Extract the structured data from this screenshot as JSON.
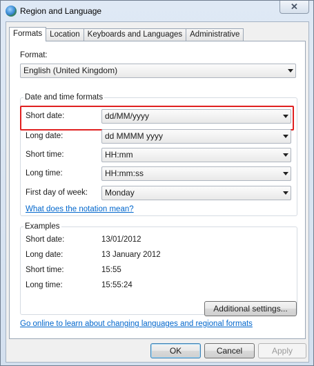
{
  "window": {
    "title": "Region and Language",
    "close_glyph": "✕"
  },
  "tabs": [
    {
      "label": "Formats",
      "active": true
    },
    {
      "label": "Location",
      "active": false
    },
    {
      "label": "Keyboards and Languages",
      "active": false
    },
    {
      "label": "Administrative",
      "active": false
    }
  ],
  "formats": {
    "format_label": "Format:",
    "format_value": "English (United Kingdom)",
    "datetime_group_title": "Date and time formats",
    "short_date_label": "Short date:",
    "short_date_value": "dd/MM/yyyy",
    "long_date_label": "Long date:",
    "long_date_value": "dd MMMM yyyy",
    "short_time_label": "Short time:",
    "short_time_value": "HH:mm",
    "long_time_label": "Long time:",
    "long_time_value": "HH:mm:ss",
    "first_day_label": "First day of week:",
    "first_day_value": "Monday",
    "notation_link": "What does the notation mean?"
  },
  "examples": {
    "title": "Examples",
    "short_date_label": "Short date:",
    "short_date_value": "13/01/2012",
    "long_date_label": "Long date:",
    "long_date_value": "13 January 2012",
    "short_time_label": "Short time:",
    "short_time_value": "15:55",
    "long_time_label": "Long time:",
    "long_time_value": "15:55:24"
  },
  "additional_settings_label": "Additional settings...",
  "online_link": "Go online to learn about changing languages and regional formats",
  "footer": {
    "ok_label": "OK",
    "cancel_label": "Cancel",
    "apply_label": "Apply"
  },
  "colors": {
    "highlight": "#e02020",
    "link": "#0066cc"
  }
}
